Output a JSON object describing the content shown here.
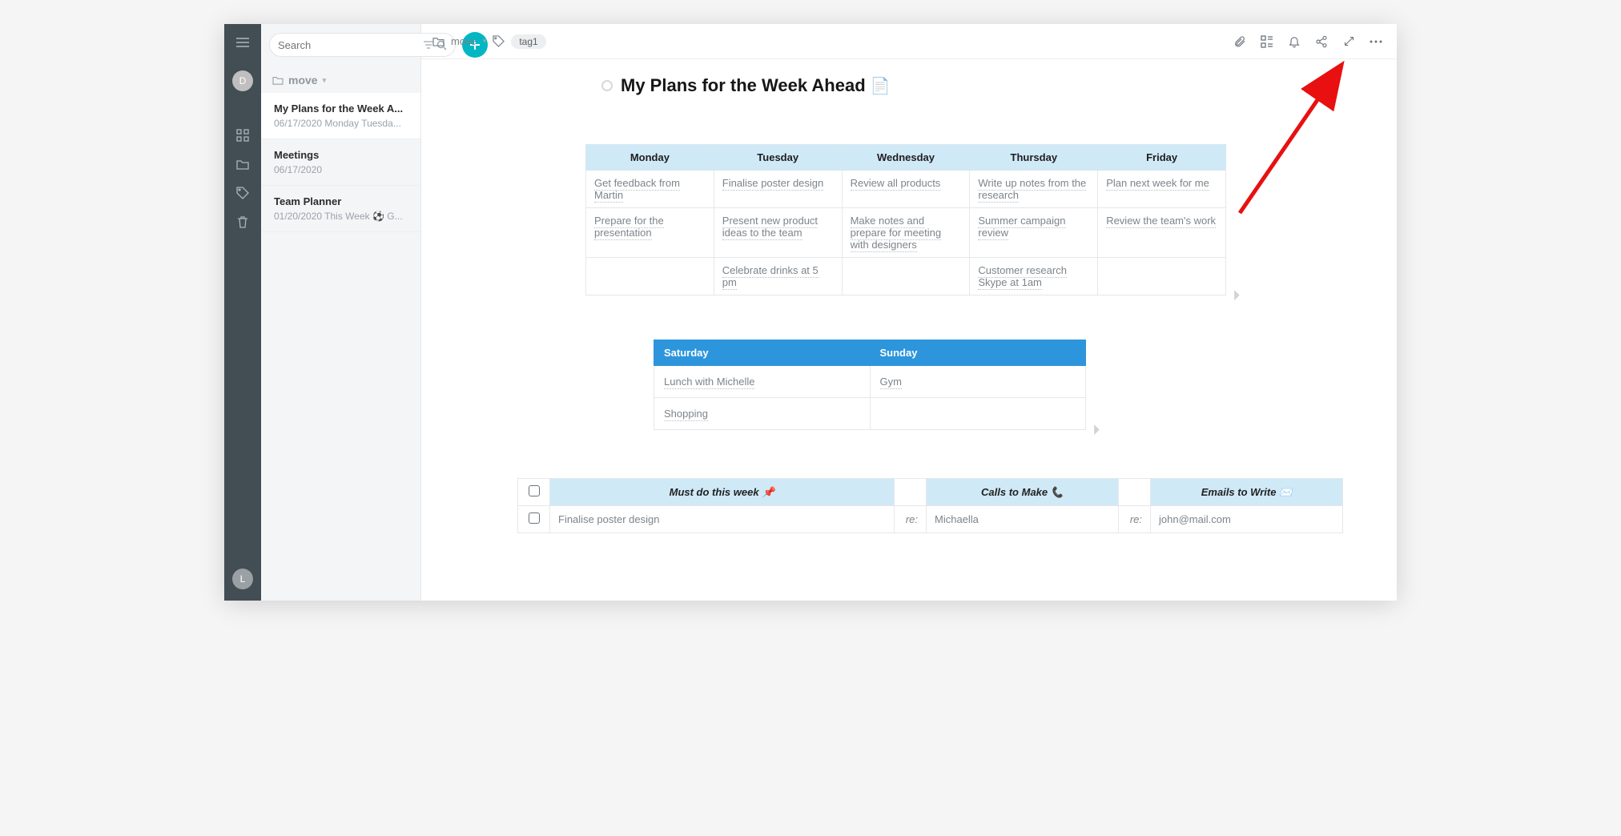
{
  "sidebar": {
    "search_placeholder": "Search",
    "folder_label": "move",
    "avatar_top": "D",
    "avatar_bottom": "L",
    "notes": [
      {
        "title": "My Plans for the Week A...",
        "meta": "06/17/2020 Monday Tuesda..."
      },
      {
        "title": "Meetings",
        "meta": "06/17/2020"
      },
      {
        "title": "Team Planner",
        "meta": "01/20/2020 This Week ⚽ G..."
      }
    ]
  },
  "breadcrumb": {
    "folder": "move",
    "tag": "tag1"
  },
  "doc": {
    "title": "My Plans for the Week Ahead",
    "title_emoji": "📄"
  },
  "week": {
    "headers": [
      "Monday",
      "Tuesday",
      "Wednesday",
      "Thursday",
      "Friday"
    ],
    "rows": [
      [
        "Get feedback from Martin",
        "Finalise poster design",
        "Review all products",
        "Write up notes from the research",
        "Plan next week for me"
      ],
      [
        "Prepare for the presentation",
        "Present new product ideas to the team",
        "Make notes and prepare for meeting with designers",
        "Summer campaign review",
        "Review the team's work"
      ],
      [
        "",
        "Celebrate drinks at 5 pm",
        "",
        "Customer research Skype at 1am",
        ""
      ]
    ]
  },
  "weekend": {
    "headers": [
      "Saturday",
      "Sunday"
    ],
    "rows": [
      [
        "Lunch with Michelle",
        "Gym"
      ],
      [
        "Shopping",
        ""
      ]
    ]
  },
  "todo": {
    "headers": {
      "must": "Must do this week",
      "must_emoji": "📌",
      "calls": "Calls to Make",
      "calls_emoji": "📞",
      "emails": "Emails to Write",
      "emails_emoji": "✉️"
    },
    "re_label": "re:",
    "rows": [
      {
        "must": "Finalise poster design",
        "call": "Michaella",
        "email": "john@mail.com"
      }
    ]
  }
}
